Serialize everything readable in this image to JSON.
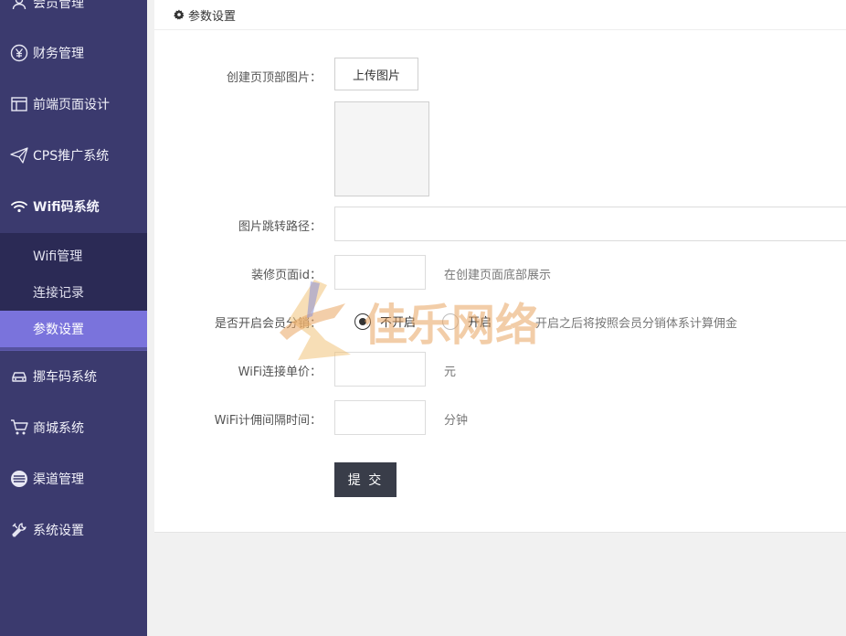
{
  "sidebar": {
    "items": [
      {
        "label": "会员管理",
        "icon": "user-icon"
      },
      {
        "label": "财务管理",
        "icon": "yen-icon"
      },
      {
        "label": "前端页面设计",
        "icon": "layout-icon"
      },
      {
        "label": "CPS推广系统",
        "icon": "paper-plane-icon"
      },
      {
        "label": "Wifi码系统",
        "icon": "wifi-icon"
      },
      {
        "label": "挪车码系统",
        "icon": "car-icon"
      },
      {
        "label": "商城系统",
        "icon": "cart-icon"
      },
      {
        "label": "渠道管理",
        "icon": "channel-icon"
      },
      {
        "label": "系统设置",
        "icon": "tools-icon"
      }
    ],
    "submenu": [
      {
        "label": "Wifi管理"
      },
      {
        "label": "连接记录"
      },
      {
        "label": "参数设置",
        "active": true
      }
    ]
  },
  "panel": {
    "title": "参数设置",
    "title_icon": "gear-icon"
  },
  "form": {
    "top_image_label": "创建页顶部图片：",
    "upload_button": "上传图片",
    "redirect_label": "图片跳转路径：",
    "redirect_value": "",
    "decor_id_label": "装修页面id：",
    "decor_id_value": "",
    "decor_id_hint": "在创建页面底部展示",
    "distribution_label": "是否开启会员分销：",
    "distribution_options": [
      "不开启",
      "开启"
    ],
    "distribution_selected": "不开启",
    "distribution_hint": "开启之后将按照会员分销体系计算佣金",
    "price_label": "WiFi连接单价：",
    "price_value": "",
    "price_unit": "元",
    "interval_label": "WiFi计佣间隔时间：",
    "interval_value": "",
    "interval_unit": "分钟",
    "submit_label": "提 交"
  },
  "watermark": {
    "text": "佳乐网络"
  },
  "colors": {
    "sidebar_bg": "#3b3a6e",
    "submenu_bg": "#2b2a55",
    "active_bg": "#7a73dc",
    "submit_bg": "#393d49"
  }
}
